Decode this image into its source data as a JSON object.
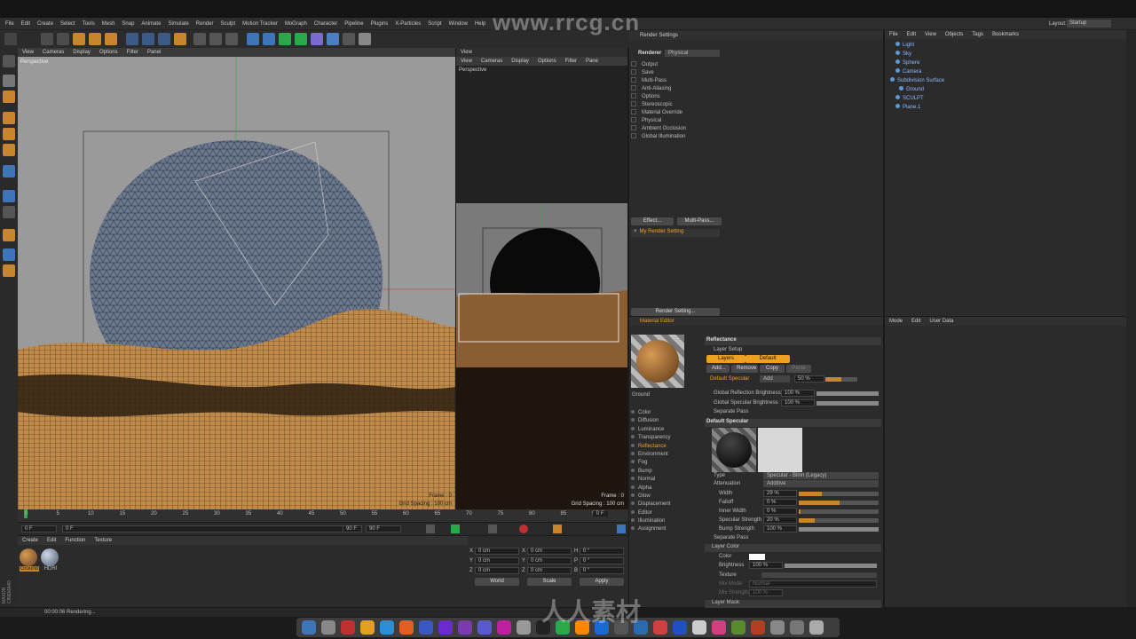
{
  "watermark": "www.rrcg.cn",
  "watermark2": "人人素材",
  "menu": [
    "File",
    "Edit",
    "Create",
    "Select",
    "Tools",
    "Mesh",
    "Snap",
    "Animate",
    "Simulate",
    "Render",
    "Sculpt",
    "Motion Tracker",
    "MoGraph",
    "Character",
    "Pipeline",
    "Plugins",
    "X-Particles",
    "Script",
    "Window",
    "Help"
  ],
  "layout_label": "Layout:",
  "layout_value": "Startup",
  "viewport1": {
    "menu": [
      "View",
      "Cameras",
      "Display",
      "Options",
      "Filter",
      "Panel"
    ],
    "label": "Perspective",
    "grid": "Grid Spacing : 100 cm",
    "frame": "Frame : 0"
  },
  "viewport2": {
    "menu": [
      "View",
      "Cameras",
      "Display",
      "Options",
      "Filter",
      "Pane"
    ],
    "label": "Perspective",
    "grid": "Grid Spacing : 100 cm",
    "frame": "Frame : 0",
    "title": "View"
  },
  "timeline": {
    "ticks": [
      "0",
      "5",
      "10",
      "15",
      "20",
      "25",
      "30",
      "35",
      "40",
      "45",
      "50",
      "55",
      "60",
      "65",
      "70",
      "75",
      "80",
      "85",
      "90"
    ],
    "start": "0 F",
    "start2": "0 F",
    "end": "90 F",
    "end2": "90 F",
    "cur": "0 F"
  },
  "material_manager": {
    "menu": [
      "Create",
      "Edit",
      "Function",
      "Texture"
    ],
    "materials": [
      "Ground",
      "HDRI"
    ]
  },
  "coords": {
    "x": "X",
    "y": "Y",
    "z": "Z",
    "xv": "0 cm",
    "yv": "0 cm",
    "zv": "0 cm",
    "sxv": "0 cm",
    "syv": "0 cm",
    "szv": "0 cm",
    "h": "H",
    "p": "P",
    "b": "B",
    "hv": "0 °",
    "pv": "0 °",
    "bv": "0 °",
    "world": "World",
    "scale": "Scale",
    "apply": "Apply"
  },
  "status": "00:00:06 Rendering...",
  "render_settings": {
    "title": "Render Settings",
    "renderer_label": "Renderer",
    "renderer": "Physical",
    "items": [
      "Output",
      "Save",
      "Multi-Pass",
      "Anti-Aliasing",
      "Options",
      "Stereoscopic",
      "Material Override",
      "Physical",
      "Ambient Occlusion",
      "Global Illumination"
    ],
    "effect_btn": "Effect...",
    "multipass_btn": "Multi-Pass...",
    "preset": "My Render Setting",
    "render_setting_btn": "Render Setting..."
  },
  "objects": {
    "menu": [
      "File",
      "Edit",
      "View",
      "Objects",
      "Tags",
      "Bookmarks"
    ],
    "items": [
      "Light",
      "Sky",
      "Sphere",
      "Camera",
      "Subdivision Surface",
      "Ground",
      "SCULPT",
      "Plane.1"
    ]
  },
  "attributes": {
    "menu": [
      "Mode",
      "Edit",
      "User Data"
    ]
  },
  "material_editor": {
    "title": "Material Editor",
    "mat_name": "Ground",
    "channels": [
      "Color",
      "Diffusion",
      "Luminance",
      "Transparency",
      "Reflectance",
      "Environment",
      "Fog",
      "Bump",
      "Normal",
      "Alpha",
      "Glow",
      "Displacement",
      "Editor",
      "Illumination",
      "Assignment"
    ],
    "active": "Reflectance",
    "section": "Reflectance",
    "layer_setup": "Layer Setup",
    "tab_layers": "Layers",
    "tab_default": "Default Specular",
    "b_add": "Add...",
    "b_remove": "Remove",
    "b_copy": "Copy",
    "b_paste": "Paste",
    "layer_name": "Default Specular",
    "layer_mode": "Add",
    "layer_pct": "50 %",
    "global_refl": "Global Reflection Brightness",
    "global_refl_v": "100 %",
    "global_spec": "Global Specular Brightness",
    "global_spec_v": "100 %",
    "sep_pass": "Separate Pass",
    "default_spec": "Default Specular",
    "type_l": "Type",
    "type_v": "Specular - Blinn (Legacy)",
    "atten_l": "Attenuation",
    "atten_v": "Additive",
    "width_l": "Width",
    "width_v": "29 %",
    "falloff_l": "Falloff",
    "falloff_v": "0 %",
    "inner_l": "Inner Width",
    "inner_v": "0 %",
    "specstr_l": "Specular Strength",
    "specstr_v": "20 %",
    "bumpstr_l": "Bump Strength",
    "bumpstr_v": "100 %",
    "sep_pass2": "Separate Pass",
    "layer_color": "Layer Color",
    "color_l": "Color",
    "bright_l": "Brightness",
    "bright_v": "100 %",
    "texture_l": "Texture",
    "mixmode_l": "Mix Mode",
    "mixmode_v": "Normal",
    "mixstr_l": "Mix Strength",
    "mixstr_v": "100 %",
    "layer_mask": "Layer Mask"
  },
  "colors": {
    "accent": "#f0a020",
    "wire": "#5a6a80",
    "sand": "#c08a4a"
  }
}
